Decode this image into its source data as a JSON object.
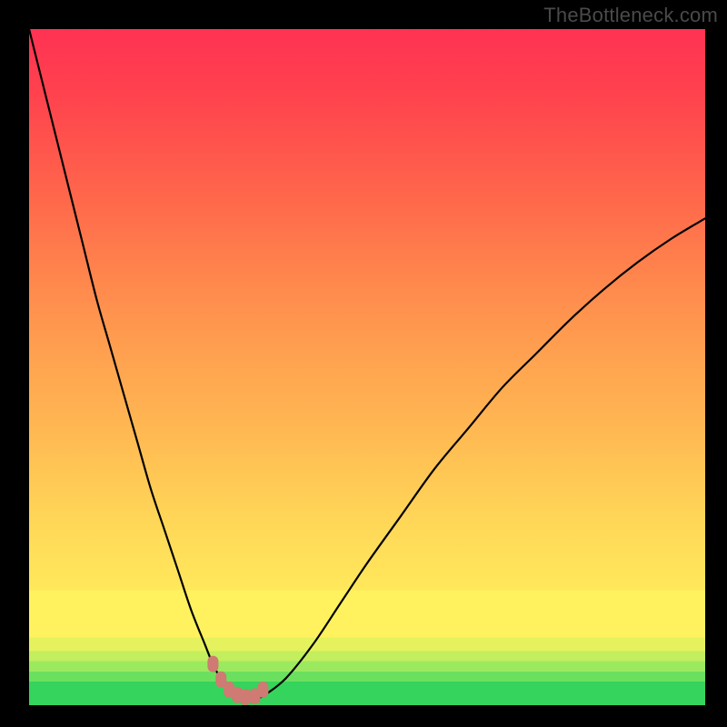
{
  "attribution": "TheBottleneck.com",
  "colors": {
    "frame": "#000000",
    "curve": "#000000",
    "bead": "#cf7a72",
    "gradient_top": "#ff3253",
    "gradient_bottom": "#35d45c"
  },
  "chart_data": {
    "type": "line",
    "title": "",
    "xlabel": "",
    "ylabel": "",
    "xlim": [
      0,
      100
    ],
    "ylim": [
      0,
      100
    ],
    "x": [
      0,
      2,
      4,
      6,
      8,
      10,
      12,
      14,
      16,
      18,
      20,
      22,
      24,
      26,
      27,
      28,
      29,
      30,
      31,
      32,
      33,
      34,
      35,
      38,
      42,
      46,
      50,
      55,
      60,
      65,
      70,
      75,
      80,
      85,
      90,
      95,
      100
    ],
    "y": [
      100,
      92,
      84,
      76,
      68,
      60,
      53,
      46,
      39,
      32,
      26,
      20,
      14,
      9,
      6.5,
      4.5,
      3,
      2,
      1.4,
      1.1,
      1,
      1.1,
      1.6,
      4,
      9,
      15,
      21,
      28,
      35,
      41,
      47,
      52,
      57,
      61.5,
      65.5,
      69,
      72
    ],
    "bead_positions_x": [
      27.2,
      28.4,
      29.6,
      30.8,
      32.0,
      33.4,
      34.6
    ],
    "bead_positions_y": [
      6.1,
      3.8,
      2.3,
      1.5,
      1.2,
      1.3,
      2.3
    ],
    "notes": "V-shaped bottleneck curve on rainbow heat gradient. Minimum ≈ (31, 1). Values estimated from pixels; axes are unlabeled in source."
  }
}
